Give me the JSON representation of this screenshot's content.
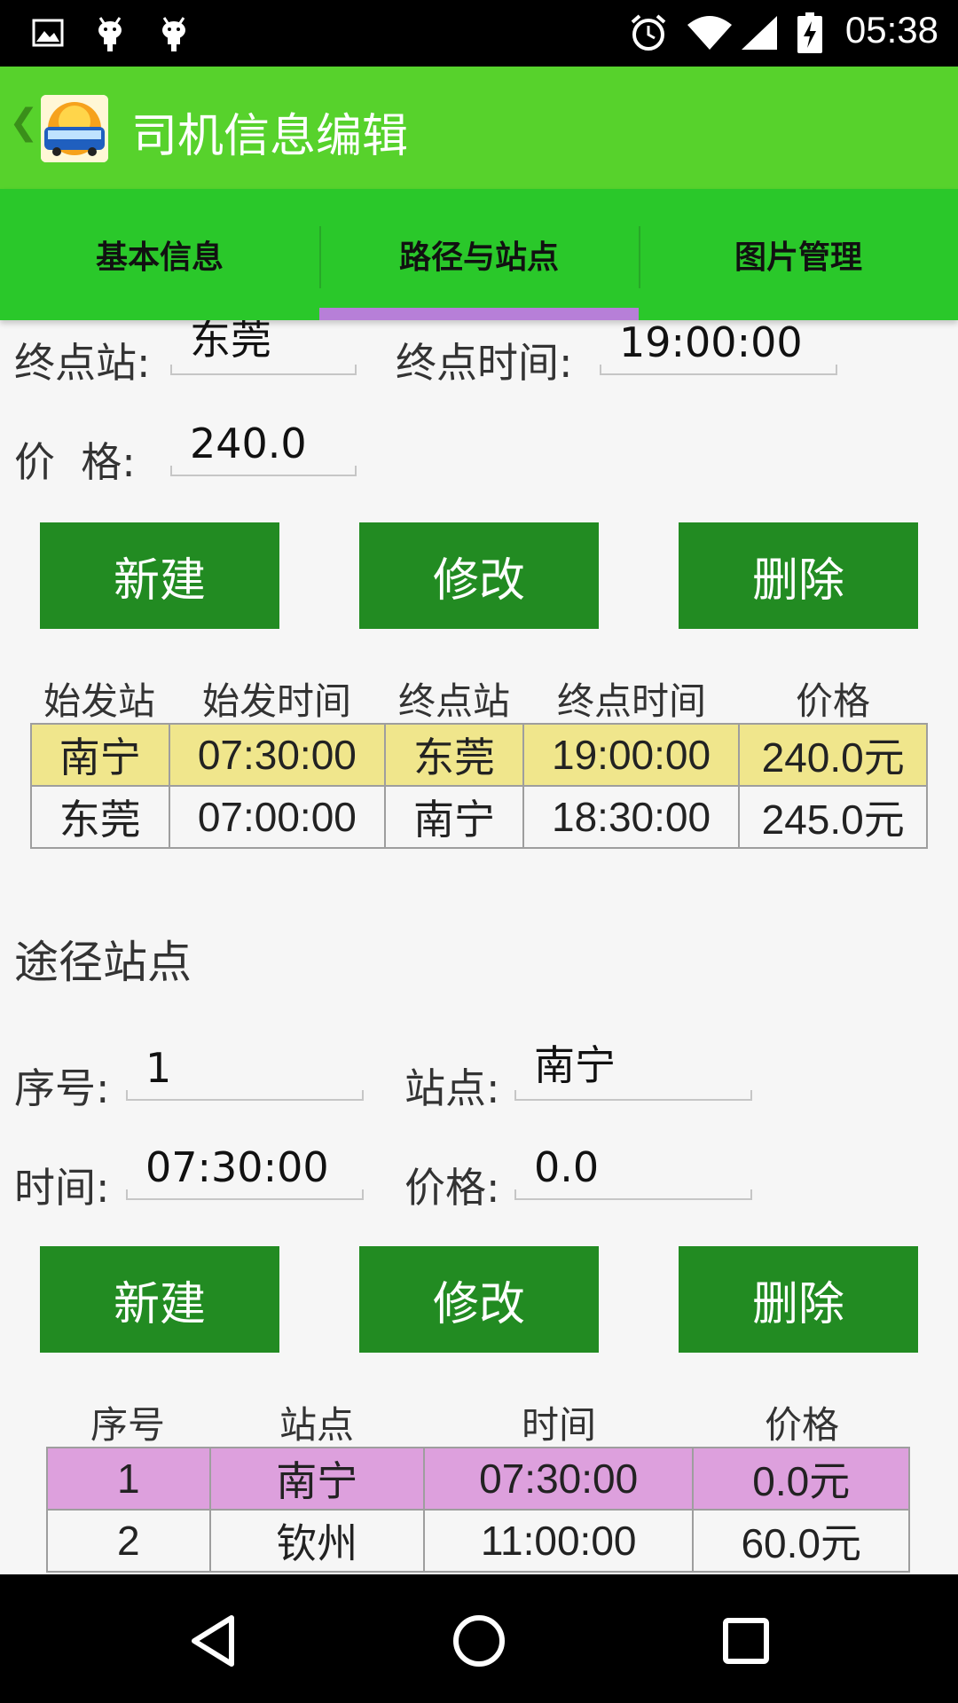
{
  "status_bar": {
    "time": "05:38",
    "icons": [
      "image-icon",
      "android-icon",
      "android-icon",
      "alarm-icon",
      "wifi-icon",
      "signal-icon",
      "battery-charging-icon"
    ]
  },
  "app_bar": {
    "title": "司机信息编辑",
    "back_icon": "chevron-left-icon",
    "logo_icon": "bus-logo-icon"
  },
  "tabs": [
    {
      "label": "基本信息",
      "active": false
    },
    {
      "label": "路径与站点",
      "active": true
    },
    {
      "label": "图片管理",
      "active": false
    }
  ],
  "route_form": {
    "end_station_label": "终点站:",
    "end_station_value": "东莞",
    "end_time_label": "终点时间:",
    "end_time_value": "19:00:00",
    "price_label": "价  格:",
    "price_value": "240.0"
  },
  "route_buttons": {
    "new": "新建",
    "modify": "修改",
    "delete": "删除"
  },
  "route_table": {
    "headers": [
      "始发站",
      "始发时间",
      "终点站",
      "终点时间",
      "价格"
    ],
    "rows": [
      [
        "南宁",
        "07:30:00",
        "东莞",
        "19:00:00",
        "240.0元"
      ],
      [
        "东莞",
        "07:00:00",
        "南宁",
        "18:30:00",
        "245.0元"
      ]
    ],
    "selected_row_color": "#f0e68c"
  },
  "stops_section": {
    "title": "途径站点",
    "seq_label": "序号:",
    "seq_value": "1",
    "station_label": "站点:",
    "station_value": "南宁",
    "time_label": "时间:",
    "time_value": "07:30:00",
    "price_label": "价格:",
    "price_value": "0.0"
  },
  "stop_buttons": {
    "new": "新建",
    "modify": "修改",
    "delete": "删除"
  },
  "stops_table": {
    "headers": [
      "序号",
      "站点",
      "时间",
      "价格"
    ],
    "rows": [
      [
        "1",
        "南宁",
        "07:30:00",
        "0.0元"
      ],
      [
        "2",
        "钦州",
        "11:00:00",
        "60.0元"
      ]
    ],
    "selected_row_color": "#dda0dd"
  },
  "colors": {
    "app_bar": "#57d22c",
    "tab_bar": "#2ac82a",
    "tab_indicator": "#b77fd8",
    "button": "#228b22"
  },
  "nav_bar": {
    "icons": [
      "back-triangle-icon",
      "home-circle-icon",
      "recents-square-icon"
    ]
  }
}
